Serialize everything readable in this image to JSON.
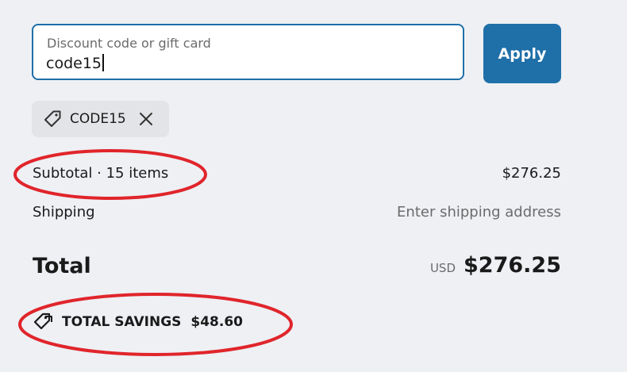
{
  "discount": {
    "placeholder": "Discount code or gift card",
    "value": "code15",
    "apply_label": "Apply"
  },
  "applied_code": {
    "label": "CODE15",
    "icon": "tag-icon",
    "remove_icon": "close-icon"
  },
  "summary": {
    "subtotal_label": "Subtotal · 15 items",
    "subtotal_value": "$276.25",
    "shipping_label": "Shipping",
    "shipping_value": "Enter shipping address",
    "total_label": "Total",
    "currency": "USD",
    "total_value": "$276.25"
  },
  "savings": {
    "label": "TOTAL SAVINGS",
    "amount": "$48.60",
    "icon": "tag-icon"
  },
  "colors": {
    "accent": "#1f6fa8",
    "background": "#eef0f4",
    "annotation": "#e0252b"
  }
}
